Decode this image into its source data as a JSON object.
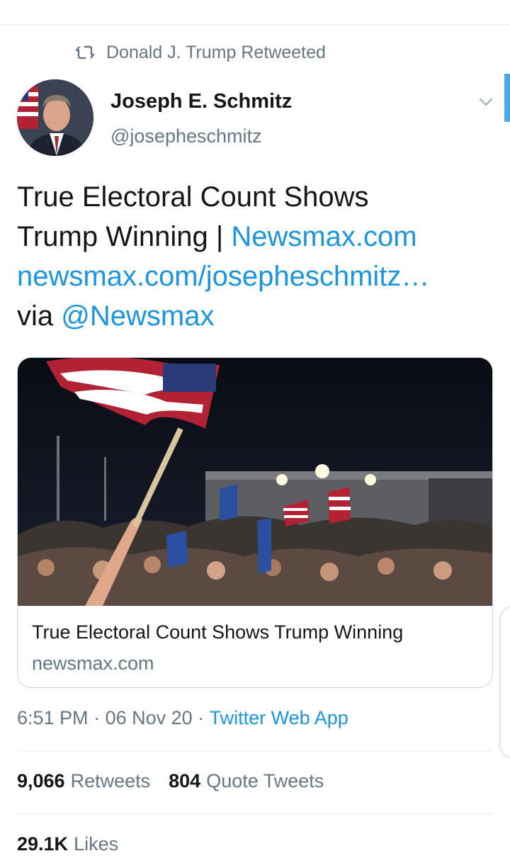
{
  "retweet_banner": {
    "text": "Donald J. Trump Retweeted",
    "icon": "retweet-icon"
  },
  "author": {
    "display_name": "Joseph E. Schmitz",
    "handle": "@josepheschmitz",
    "avatar": "avatar-photo"
  },
  "tweet": {
    "line1": "True Electoral Count Shows",
    "line2_text": "Trump Winning | ",
    "line2_link": "Newsmax.com",
    "line3_link": "newsmax.com/josepheschmitz…",
    "line4_text": "via ",
    "line4_mention": "@Newsmax"
  },
  "card": {
    "title": "True Electoral Count Shows Trump Winning",
    "domain": "newsmax.com",
    "image": "night-rally-crowd-with-flags"
  },
  "meta": {
    "time": "6:51 PM",
    "separator1": " · ",
    "date": "06 Nov 20",
    "separator2": " · ",
    "source": "Twitter Web App"
  },
  "stats": {
    "retweets_count": "9,066",
    "retweets_label": "Retweets",
    "quotes_count": "804",
    "quotes_label": "Quote Tweets",
    "likes_count": "29.1K",
    "likes_label": "Likes"
  },
  "colors": {
    "link": "#1b95e0",
    "secondary_text": "#657786",
    "primary_text": "#14171a",
    "divider": "#e6ecf0"
  }
}
